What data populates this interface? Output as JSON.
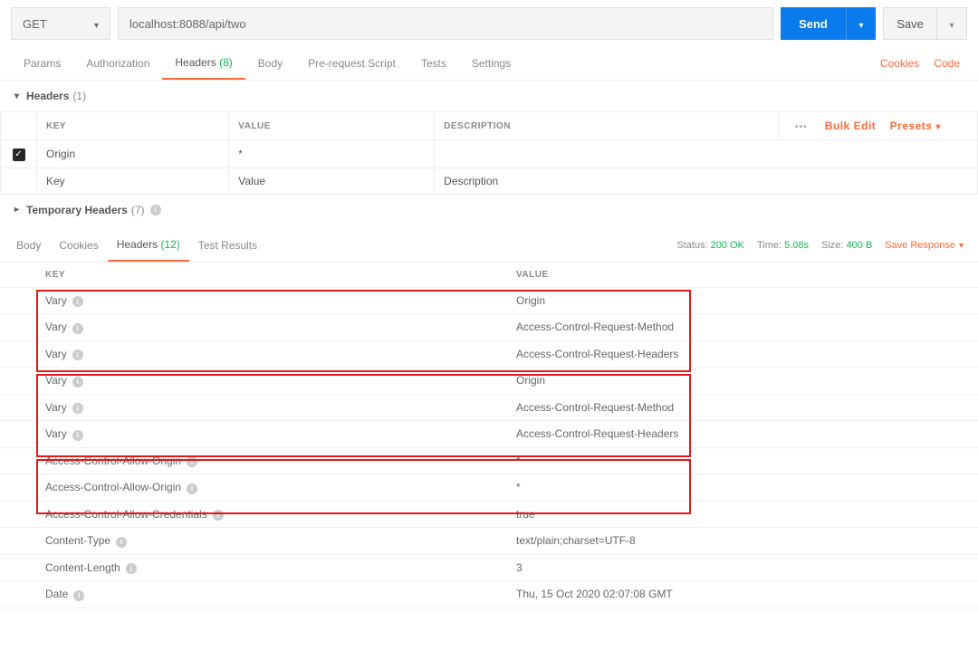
{
  "request": {
    "method": "GET",
    "url": "localhost:8088/api/two",
    "send_label": "Send",
    "save_label": "Save"
  },
  "req_tabs": {
    "params": "Params",
    "auth": "Authorization",
    "headers": "Headers",
    "headers_count": "(8)",
    "body": "Body",
    "prereq": "Pre-request Script",
    "tests": "Tests",
    "settings": "Settings",
    "cookies": "Cookies",
    "code": "Code"
  },
  "headers_section": {
    "title": "Headers",
    "count": "(1)"
  },
  "req_headers_table": {
    "cols": {
      "key": "KEY",
      "value": "VALUE",
      "desc": "DESCRIPTION"
    },
    "bulk_edit": "Bulk Edit",
    "presets": "Presets",
    "rows": [
      {
        "checked": true,
        "key": "Origin",
        "value": "*",
        "desc": ""
      }
    ],
    "placeholder": {
      "key": "Key",
      "value": "Value",
      "desc": "Description"
    }
  },
  "temp_headers": {
    "title": "Temporary Headers",
    "count": "(7)"
  },
  "resp_tabs": {
    "body": "Body",
    "cookies": "Cookies",
    "headers": "Headers",
    "headers_count": "(12)",
    "test_results": "Test Results"
  },
  "status": {
    "status_label": "Status:",
    "status_value": "200 OK",
    "time_label": "Time:",
    "time_value": "5.08s",
    "size_label": "Size:",
    "size_value": "400 B",
    "save_response": "Save Response"
  },
  "resp_headers_table": {
    "cols": {
      "key": "KEY",
      "value": "VALUE"
    },
    "rows": [
      {
        "key": "Vary",
        "value": "Origin",
        "info": true
      },
      {
        "key": "Vary",
        "value": "Access-Control-Request-Method",
        "info": true
      },
      {
        "key": "Vary",
        "value": "Access-Control-Request-Headers",
        "info": true
      },
      {
        "key": "Vary",
        "value": "Origin",
        "info": true
      },
      {
        "key": "Vary",
        "value": "Access-Control-Request-Method",
        "info": true
      },
      {
        "key": "Vary",
        "value": "Access-Control-Request-Headers",
        "info": true
      },
      {
        "key": "Access-Control-Allow-Origin",
        "value": "*",
        "info": true
      },
      {
        "key": "Access-Control-Allow-Origin",
        "value": "*",
        "info": true
      },
      {
        "key": "Access-Control-Allow-Credentials",
        "value": "true",
        "info": true
      },
      {
        "key": "Content-Type",
        "value": "text/plain;charset=UTF-8",
        "info": true
      },
      {
        "key": "Content-Length",
        "value": "3",
        "info": true
      },
      {
        "key": "Date",
        "value": "Thu, 15 Oct 2020 02:07:08 GMT",
        "info": true
      }
    ]
  }
}
